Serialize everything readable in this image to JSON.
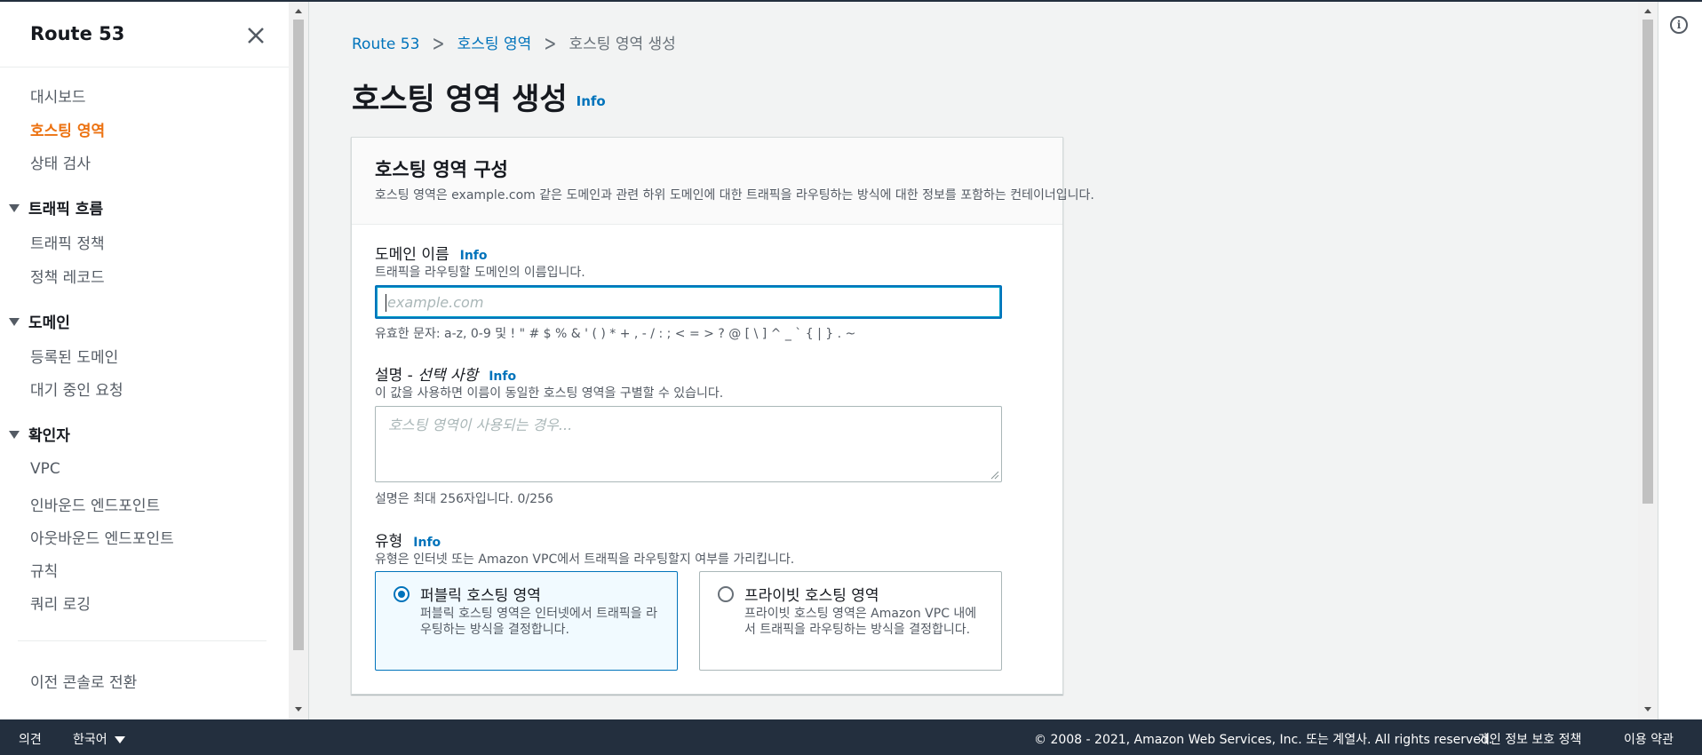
{
  "sidebar": {
    "title": "Route 53",
    "items": [
      {
        "label": "대시보드"
      },
      {
        "label": "호스팅 영역",
        "active": true
      },
      {
        "label": "상태 검사"
      }
    ],
    "sections": [
      {
        "label": "트래픽 흐름",
        "items": [
          {
            "label": "트래픽 정책"
          },
          {
            "label": "정책 레코드"
          }
        ]
      },
      {
        "label": "도메인",
        "items": [
          {
            "label": "등록된 도메인"
          },
          {
            "label": "대기 중인 요청"
          }
        ]
      },
      {
        "label": "확인자",
        "items": [
          {
            "label": "VPC"
          },
          {
            "label": "인바운드 엔드포인트"
          },
          {
            "label": "아웃바운드 엔드포인트"
          },
          {
            "label": "규칙"
          },
          {
            "label": "쿼리 로깅"
          }
        ]
      }
    ],
    "switch_console": "이전 콘솔로 전환"
  },
  "breadcrumb": {
    "root": "Route 53",
    "parent": "호스팅 영역",
    "current": "호스팅 영역 생성"
  },
  "page": {
    "title": "호스팅 영역 생성",
    "info": "Info"
  },
  "panel": {
    "title": "호스팅 영역 구성",
    "description": "호스팅 영역은 example.com 같은 도메인과 관련 하위 도메인에 대한 트래픽을 라우팅하는 방식에 대한 정보를 포함하는 컨테이너입니다.",
    "domain": {
      "label": "도메인 이름",
      "info": "Info",
      "description": "트래픽을 라우팅할 도메인의 이름입니다.",
      "placeholder": "example.com",
      "value": "",
      "constraint": "유효한 문자: a-z, 0-9 및 ! \" # $ % & ' ( ) * + , - / : ; < = > ? @ [ \\ ] ^ _ ` { | } . ~"
    },
    "comment": {
      "label": "설명 - ",
      "label_optional": "선택 사항",
      "info": "Info",
      "description": "이 값을 사용하면 이름이 동일한 호스팅 영역을 구별할 수 있습니다.",
      "placeholder": "호스팅 영역이 사용되는 경우...",
      "value": "",
      "constraint": "설명은 최대 256자입니다. 0/256"
    },
    "type": {
      "label": "유형",
      "info": "Info",
      "description": "유형은 인터넷 또는 Amazon VPC에서 트래픽을 라우팅할지 여부를 가리킵니다.",
      "options": [
        {
          "title": "퍼블릭 호스팅 영역",
          "description": "퍼블릭 호스팅 영역은 인터넷에서 트래픽을 라우팅하는 방식을 결정합니다.",
          "selected": true
        },
        {
          "title": "프라이빗 호스팅 영역",
          "description": "프라이빗 호스팅 영역은 Amazon VPC 내에서 트래픽을 라우팅하는 방식을 결정합니다.",
          "selected": false
        }
      ]
    }
  },
  "footer": {
    "feedback": "의견",
    "language": "한국어",
    "copyright": "© 2008 - 2021, Amazon Web Services, Inc. 또는 계열사. All rights reserved.",
    "privacy": "개인 정보 보호 정책",
    "terms": "이용 약관"
  },
  "colors": {
    "accent_active": "#ec7211",
    "link": "#0073bb",
    "footer_bg": "#232f3e"
  }
}
